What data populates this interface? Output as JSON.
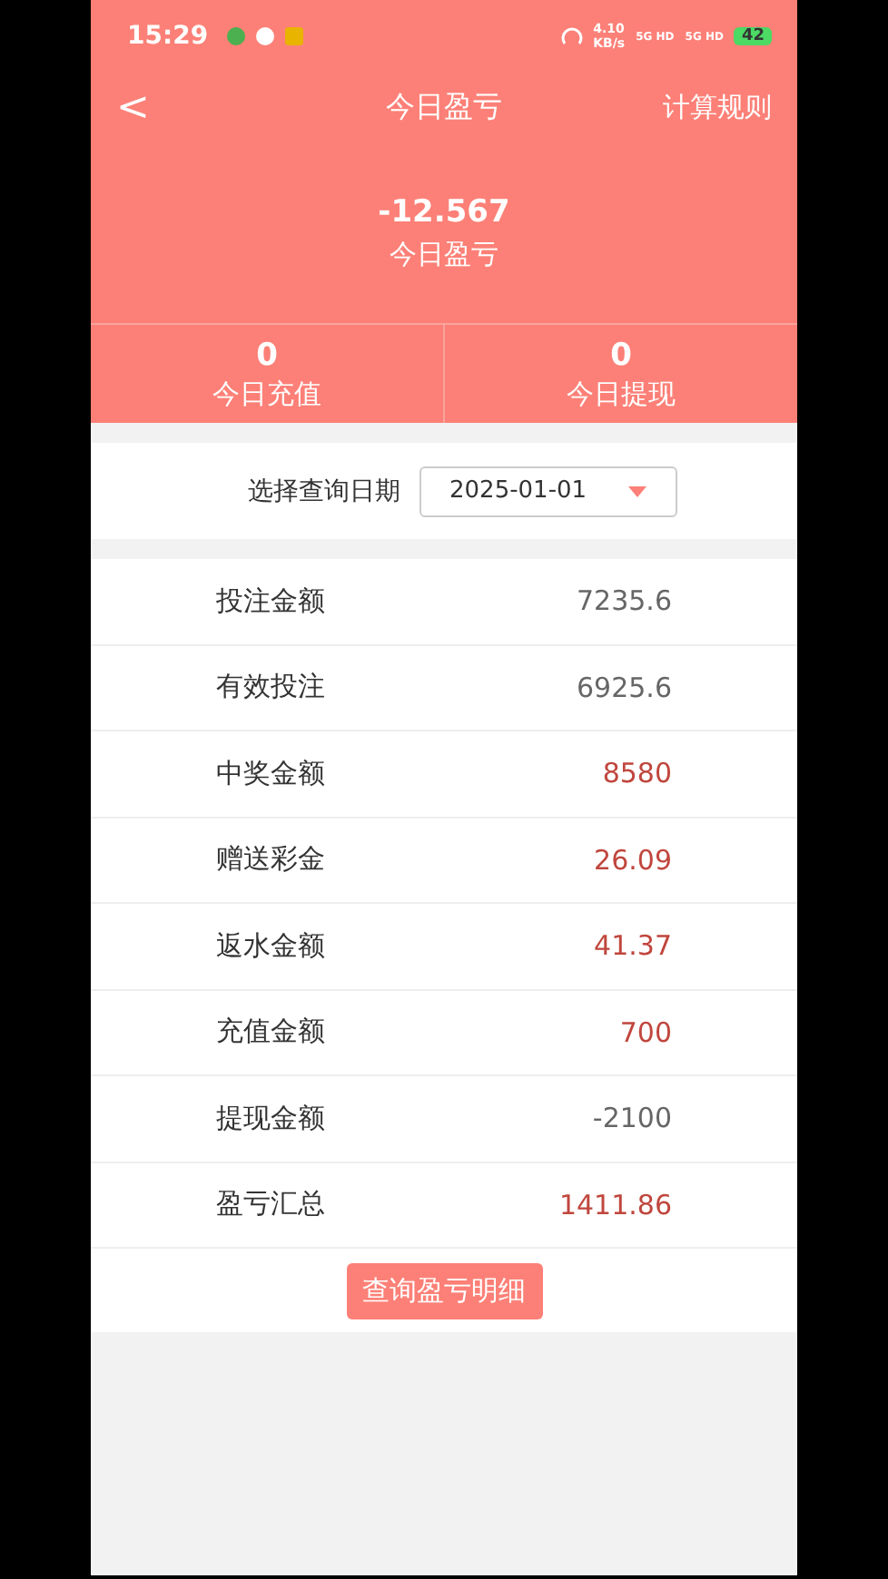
{
  "status_bar": {
    "time": "15:29",
    "speed": "4.10",
    "speed_unit": "KB/s",
    "networks": [
      "5G HD",
      "5G HD"
    ],
    "battery": "42"
  },
  "nav": {
    "back": "<",
    "title": "今日盈亏",
    "action": "计算规则"
  },
  "summary": {
    "value": "-12.567",
    "label": "今日盈亏"
  },
  "stats": [
    {
      "value": "0",
      "label": "今日充值"
    },
    {
      "value": "0",
      "label": "今日提现"
    }
  ],
  "date_filter": {
    "label": "选择查询日期",
    "value": "2025-01-01"
  },
  "rows": [
    {
      "label": "投注金额",
      "value": "7235.6",
      "color": "#666666"
    },
    {
      "label": "有效投注",
      "value": "6925.6",
      "color": "#666666"
    },
    {
      "label": "中奖金额",
      "value": "8580",
      "color": "#c0463d"
    },
    {
      "label": "赠送彩金",
      "value": "26.09",
      "color": "#c0463d"
    },
    {
      "label": "返水金额",
      "value": "41.37",
      "color": "#c0463d"
    },
    {
      "label": "充值金额",
      "value": "700",
      "color": "#c0463d"
    },
    {
      "label": "提现金额",
      "value": "-2100",
      "color": "#666666"
    },
    {
      "label": "盈亏汇总",
      "value": "1411.86",
      "color": "#c0463d"
    }
  ],
  "detail_button": "查询盈亏明细"
}
